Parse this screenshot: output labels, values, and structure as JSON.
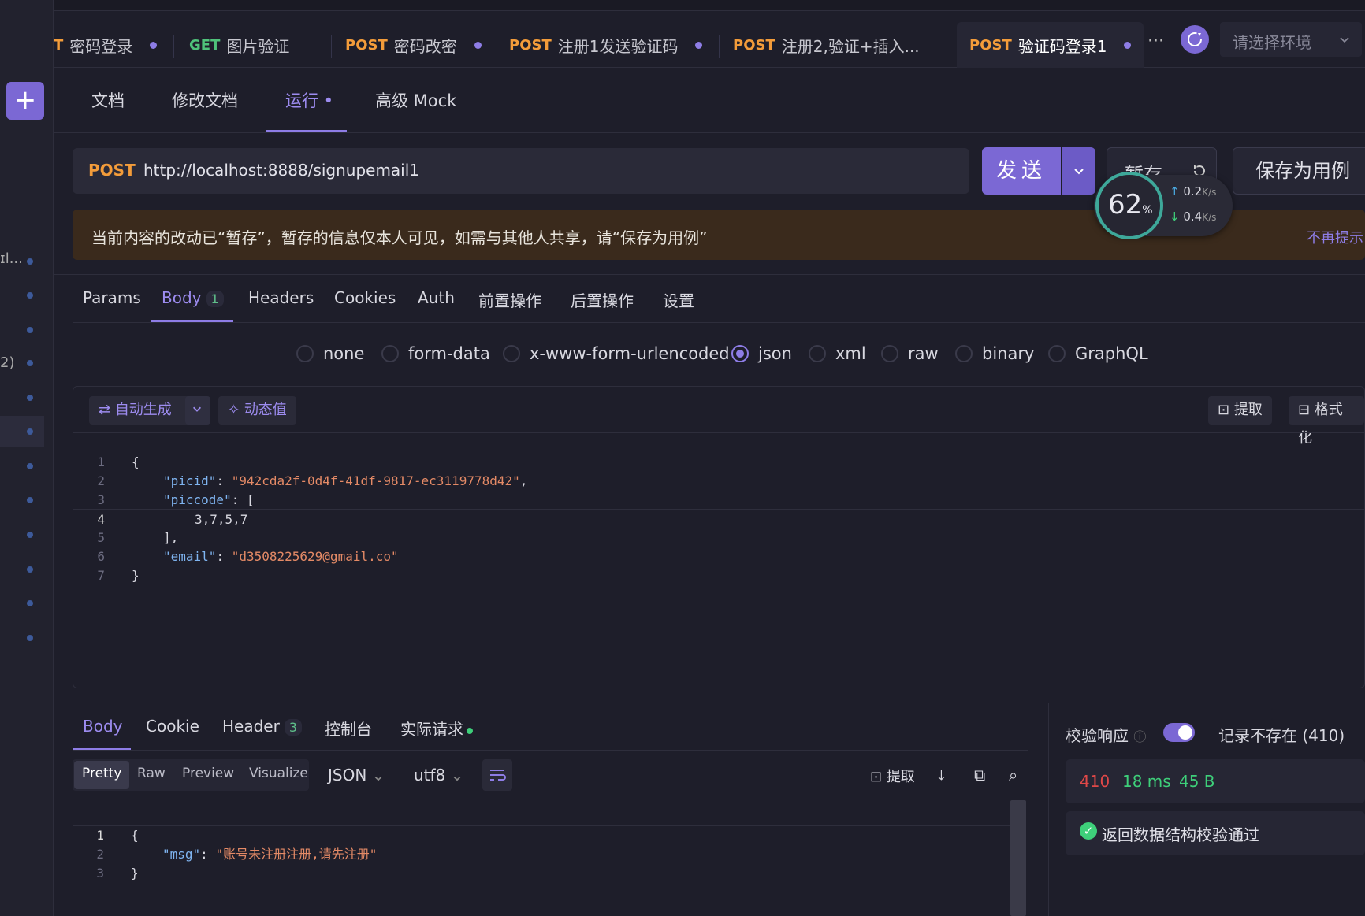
{
  "tabs": [
    {
      "method": "T",
      "name": "密码登录"
    },
    {
      "method": "GET",
      "name": "图片验证"
    },
    {
      "method": "POST",
      "name": "密码改密"
    },
    {
      "method": "POST",
      "name": "注册1发送验证码"
    },
    {
      "method": "POST",
      "name": "注册2,验证+插入..."
    },
    {
      "method": "POST",
      "name": "验证码登录1"
    }
  ],
  "tabs_more": "···",
  "env_select": "请选择环境",
  "subtabs": {
    "doc": "文档",
    "edit_doc": "修改文档",
    "run": "运行",
    "mock": "高级 Mock"
  },
  "request": {
    "method": "POST",
    "url": "http://localhost:8888/signupemail1",
    "send": "发送",
    "temp_save": "暂存",
    "save_as": "保存为用例"
  },
  "speed": {
    "percent": "62",
    "unit": "%",
    "up": "0.2",
    "down": "0.4",
    "rate_unit": "K/s"
  },
  "banner": {
    "text": "当前内容的改动已“暂存”，暂存的信息仅本人可见，如需与其他人共享，请“保存为用例”",
    "dismiss": "不再提示"
  },
  "rail": {
    "item1": "ɪl...",
    "item2": "2)"
  },
  "req_tabs": {
    "params": "Params",
    "body": "Body",
    "body_count": "1",
    "headers": "Headers",
    "cookies": "Cookies",
    "auth": "Auth",
    "pre": "前置操作",
    "post": "后置操作",
    "settings": "设置"
  },
  "body_types": [
    "none",
    "form-data",
    "x-www-form-urlencoded",
    "json",
    "xml",
    "raw",
    "binary",
    "GraphQL"
  ],
  "body_type_selected": "json",
  "editor_toolbar": {
    "auto_gen": "自动生成",
    "dynamic": "动态值",
    "extract": "提取",
    "format": "格式化"
  },
  "request_body": {
    "lines": [
      "1",
      "2",
      "3",
      "4",
      "5",
      "6",
      "7"
    ],
    "open": "{",
    "picid_key": "\"picid\"",
    "picid_val": "\"942cda2f-0d4f-41df-9817-ec3119778d42\"",
    "piccode_key": "\"piccode\"",
    "piccode_val": "3,7,5,7",
    "close_arr": "],",
    "email_key": "\"email\"",
    "email_val": "\"d3508225629@gmail.co\"",
    "close": "}"
  },
  "resp_tabs": {
    "body": "Body",
    "cookie": "Cookie",
    "header": "Header",
    "header_count": "3",
    "console": "控制台",
    "actual": "实际请求"
  },
  "resp_views": [
    "Pretty",
    "Raw",
    "Preview",
    "Visualize"
  ],
  "resp_format": "JSON",
  "resp_encoding": "utf8",
  "resp_extract": "提取",
  "response_body": {
    "lines": [
      "1",
      "2",
      "3"
    ],
    "open": "{",
    "msg_key": "\"msg\"",
    "msg_val": "\"账号未注册注册,请先注册\"",
    "close": "}"
  },
  "validation": {
    "label": "校验响应",
    "record": "记录不存在 (410)",
    "status": "410",
    "time": "18 ms",
    "size": "45 B",
    "result": "返回数据结构校验通过"
  }
}
